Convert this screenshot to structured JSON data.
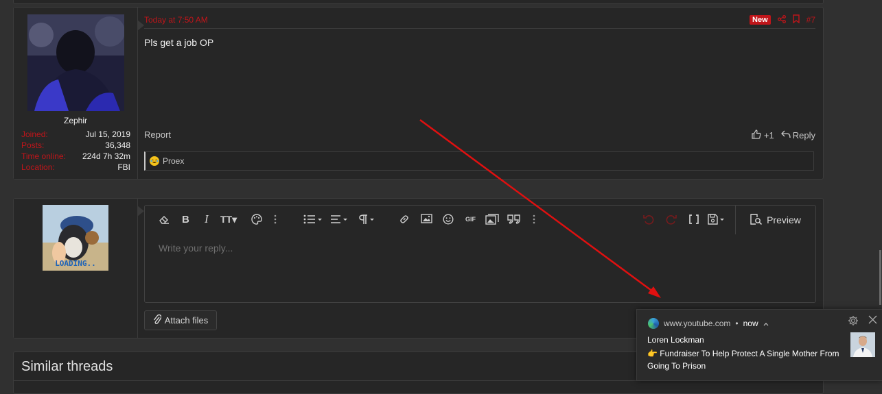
{
  "post": {
    "date": "Today at 7:50 AM",
    "badge_new": "New",
    "post_number": "#7",
    "body": "Pls get a job OP",
    "report_label": "Report",
    "like_count": "+1",
    "reply_label": "Reply",
    "reaction_user": "Proex",
    "user": {
      "name": "Zephir",
      "stats": [
        {
          "key": "Joined:",
          "value": "Jul 15, 2019"
        },
        {
          "key": "Posts:",
          "value": "36,348"
        },
        {
          "key": "Time online:",
          "value": "224d 7h 32m"
        },
        {
          "key": "Location:",
          "value": "FBI"
        }
      ]
    }
  },
  "reply_box": {
    "avatar_text": "LOADING..",
    "placeholder": "Write your reply...",
    "preview_label": "Preview",
    "attach_label": "Attach files",
    "gif_label": "GIF"
  },
  "similar": {
    "title": "Similar threads"
  },
  "notification": {
    "source": "www.youtube.com",
    "time": "now",
    "sender": "Loren Lockman",
    "message": "👉 Fundraiser To Help Protect A Single Mother From Going To Prison"
  },
  "colors": {
    "accent": "#c0151a",
    "background": "#303030",
    "panel": "#262626",
    "annotation_arrow": "#e01010"
  }
}
